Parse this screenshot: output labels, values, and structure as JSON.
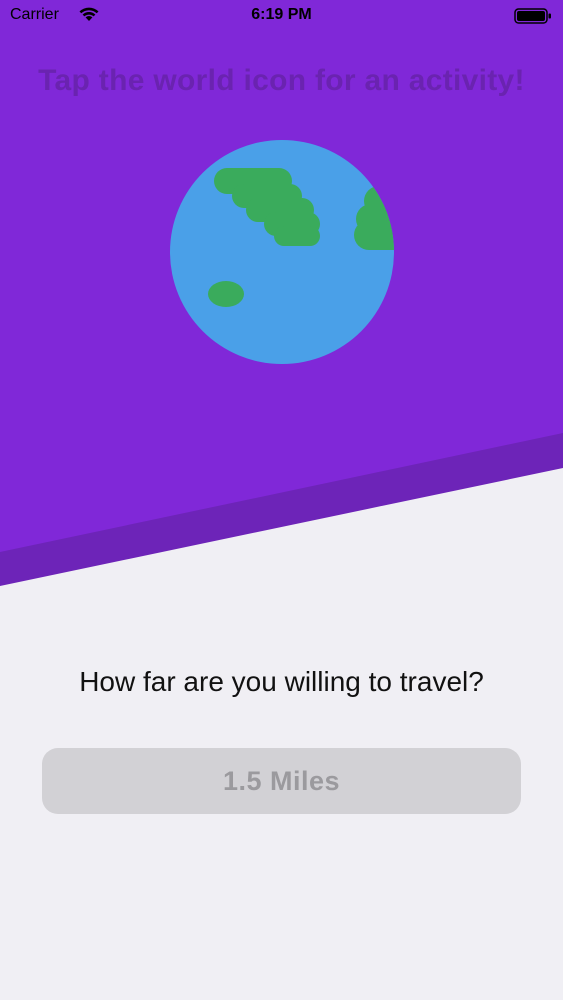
{
  "status_bar": {
    "carrier": "Carrier",
    "time": "6:19 PM"
  },
  "header": {
    "headline": "Tap the world icon for an activity!"
  },
  "main": {
    "question": "How far are you willing to travel?",
    "distance_label": "1.5 Miles"
  },
  "icons": {
    "globe": "globe-icon",
    "wifi": "wifi-icon",
    "battery": "battery-icon"
  },
  "colors": {
    "purple": "#8028d8",
    "purple_stripe": "#6d24b8",
    "headline": "#6a23b0",
    "ocean": "#4aa0e8",
    "land": "#3aab5c",
    "background": "#f0eff4",
    "button_bg": "#d2d1d5",
    "button_text": "#9b9a9e"
  }
}
